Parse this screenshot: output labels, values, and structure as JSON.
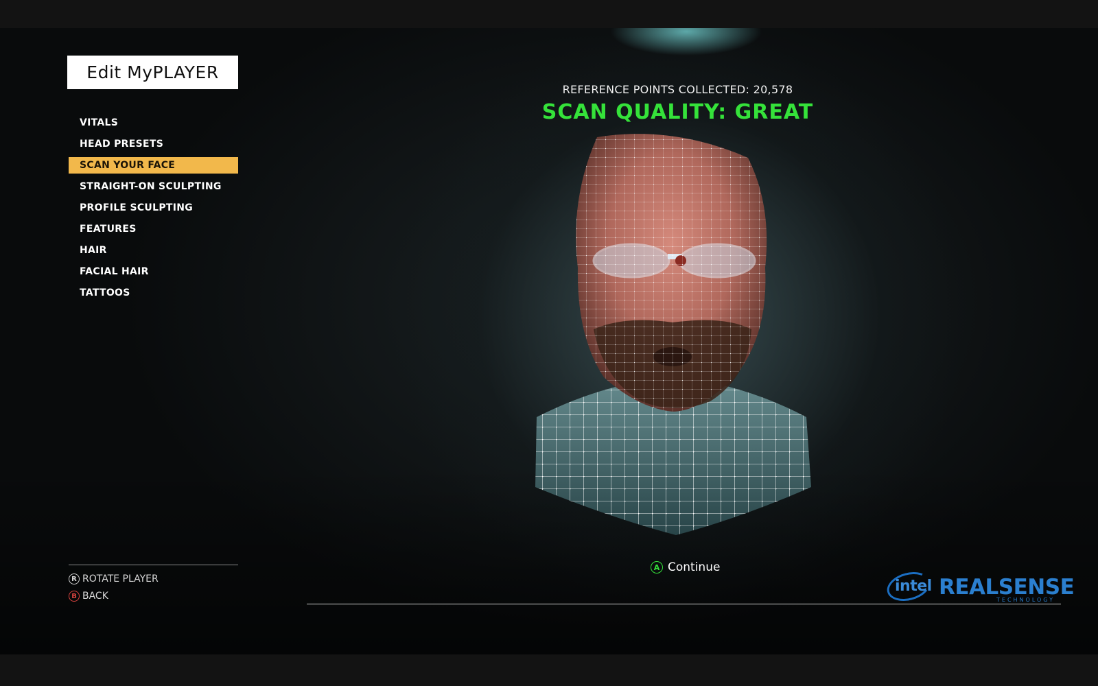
{
  "menu": {
    "title": "Edit MyPLAYER",
    "items": [
      {
        "label": "VITALS",
        "active": false
      },
      {
        "label": "HEAD PRESETS",
        "active": false
      },
      {
        "label": "SCAN YOUR FACE",
        "active": true
      },
      {
        "label": "STRAIGHT-ON SCULPTING",
        "active": false
      },
      {
        "label": "PROFILE SCULPTING",
        "active": false
      },
      {
        "label": "FEATURES",
        "active": false
      },
      {
        "label": "HAIR",
        "active": false
      },
      {
        "label": "FACIAL HAIR",
        "active": false
      },
      {
        "label": "TATTOOS",
        "active": false
      }
    ]
  },
  "controls": {
    "rotate": {
      "button": "R",
      "label": "ROTATE PLAYER"
    },
    "back": {
      "button": "B",
      "label": "BACK"
    }
  },
  "scan": {
    "reference_points": "REFERENCE POINTS COLLECTED: 20,578",
    "quality": "SCAN QUALITY: GREAT"
  },
  "continue": {
    "button": "A",
    "label": "Continue"
  },
  "branding": {
    "intel": "intel",
    "realsense": "REALSENSE",
    "technology": "TECHNOLOGY"
  },
  "colors": {
    "accent_selected": "#f2b84b",
    "quality_green": "#35e23a",
    "back_button_red": "#d9433f",
    "realsense_blue": "#2b7fcf"
  }
}
